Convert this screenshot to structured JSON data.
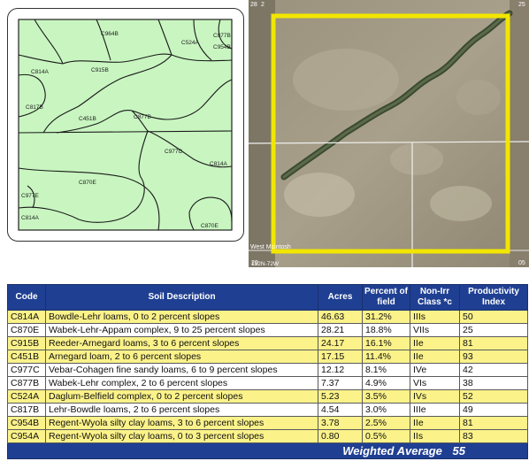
{
  "soil_map": {
    "unit_labels": [
      "C964B",
      "C524A",
      "C954B",
      "C877B",
      "C814A",
      "C915B",
      "C817B",
      "C451B",
      "C877B",
      "C977C",
      "C814A",
      "C870E",
      "C977E",
      "C814A",
      "C870E"
    ]
  },
  "aerial": {
    "corner_markers": [
      "28",
      "2",
      "25",
      "20",
      "05"
    ],
    "place_label": "West Mcintosh",
    "township_label": "132N-72W",
    "colors": {
      "field_boundary": "#f2e600",
      "road": "#f0f0f0"
    }
  },
  "table": {
    "headers": {
      "code": "Code",
      "description": "Soil Description",
      "acres": "Acres",
      "percent": "Percent of field",
      "class": "Non-Irr Class *c",
      "index": "Productivity Index"
    },
    "rows": [
      {
        "code": "C814A",
        "description": "Bowdle-Lehr loams, 0 to 2 percent slopes",
        "acres": "46.63",
        "percent": "31.2%",
        "class": "IIIs",
        "index": "50",
        "highlight": true
      },
      {
        "code": "C870E",
        "description": "Wabek-Lehr-Appam complex, 9 to 25 percent slopes",
        "acres": "28.21",
        "percent": "18.8%",
        "class": "VIIs",
        "index": "25",
        "highlight": false
      },
      {
        "code": "C915B",
        "description": "Reeder-Arnegard loams, 3 to 6 percent slopes",
        "acres": "24.17",
        "percent": "16.1%",
        "class": "IIe",
        "index": "81",
        "highlight": true
      },
      {
        "code": "C451B",
        "description": "Arnegard loam, 2 to 6 percent slopes",
        "acres": "17.15",
        "percent": "11.4%",
        "class": "IIe",
        "index": "93",
        "highlight": true
      },
      {
        "code": "C977C",
        "description": "Vebar-Cohagen fine sandy loams, 6 to 9 percent slopes",
        "acres": "12.12",
        "percent": "8.1%",
        "class": "IVe",
        "index": "42",
        "highlight": false
      },
      {
        "code": "C877B",
        "description": "Wabek-Lehr complex, 2 to 6 percent slopes",
        "acres": "7.37",
        "percent": "4.9%",
        "class": "VIs",
        "index": "38",
        "highlight": false
      },
      {
        "code": "C524A",
        "description": "Daglum-Belfield complex, 0 to 2 percent slopes",
        "acres": "5.23",
        "percent": "3.5%",
        "class": "IVs",
        "index": "52",
        "highlight": true
      },
      {
        "code": "C817B",
        "description": "Lehr-Bowdle loams, 2 to 6 percent slopes",
        "acres": "4.54",
        "percent": "3.0%",
        "class": "IIIe",
        "index": "49",
        "highlight": false
      },
      {
        "code": "C954B",
        "description": "Regent-Wyola silty clay loams, 3 to 6 percent slopes",
        "acres": "3.78",
        "percent": "2.5%",
        "class": "IIe",
        "index": "81",
        "highlight": true
      },
      {
        "code": "C954A",
        "description": "Regent-Wyola silty clay loams, 0 to 3 percent slopes",
        "acres": "0.80",
        "percent": "0.5%",
        "class": "IIs",
        "index": "83",
        "highlight": true
      }
    ],
    "footer": {
      "label": "Weighted Average",
      "value": "55"
    },
    "colors": {
      "header": "#1f3f92",
      "highlight": "#fbf28a",
      "map_fill": "#c8f5c0"
    }
  }
}
